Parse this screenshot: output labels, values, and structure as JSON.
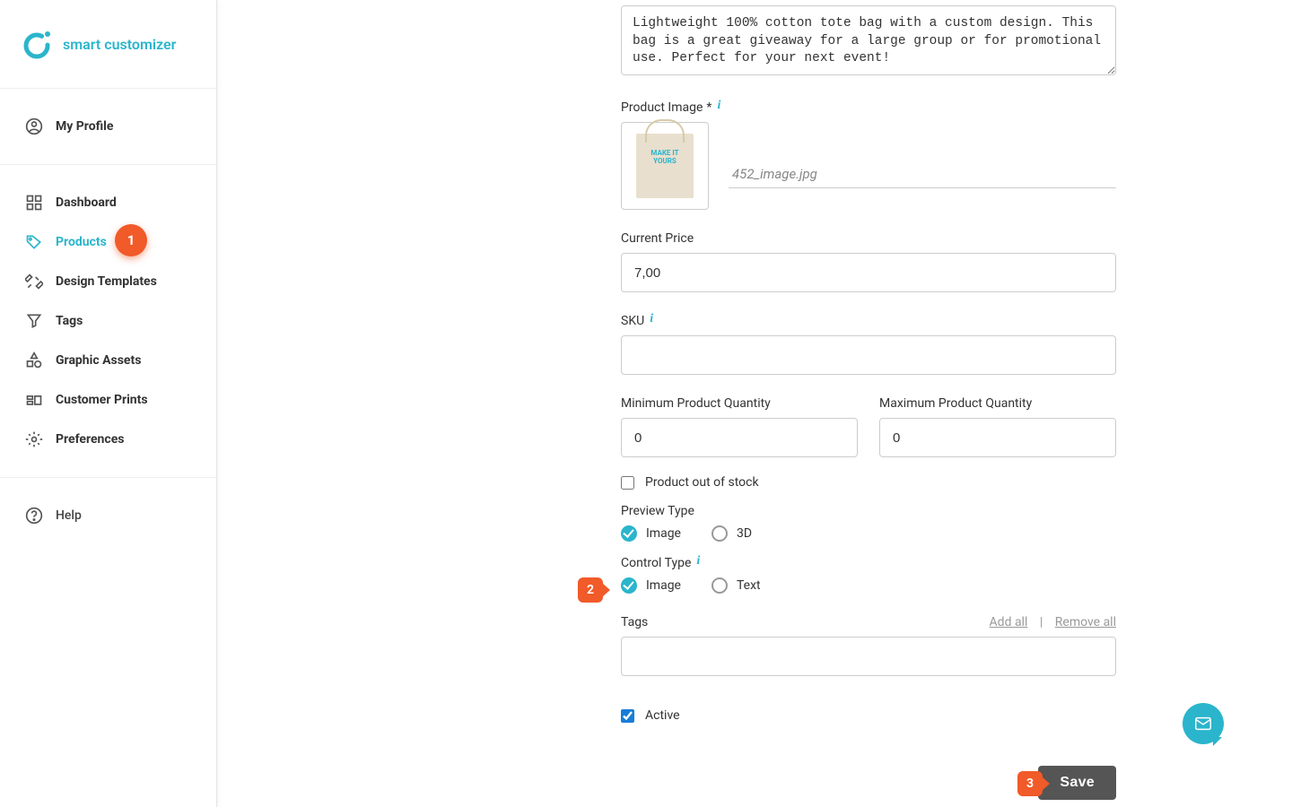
{
  "brand": {
    "name": "smart customizer"
  },
  "sidebar": {
    "items": [
      {
        "label": "My Profile"
      },
      {
        "label": "Dashboard"
      },
      {
        "label": "Products",
        "badge": "1"
      },
      {
        "label": "Design Templates"
      },
      {
        "label": "Tags"
      },
      {
        "label": "Graphic Assets"
      },
      {
        "label": "Customer Prints"
      },
      {
        "label": "Preferences"
      }
    ],
    "help": "Help"
  },
  "form": {
    "description_value": "Lightweight 100% cotton tote bag with a custom design. This bag is a great giveaway for a large group or for promotional use. Perfect for your next event!",
    "product_image_label": "Product Image",
    "image_filename": "452_image.jpg",
    "bag_text_1": "MAKE IT",
    "bag_text_2": "YOURS",
    "current_price_label": "Current Price",
    "current_price": "7,00",
    "sku_label": "SKU",
    "sku": "",
    "min_qty_label": "Minimum Product Quantity",
    "min_qty": "0",
    "max_qty_label": "Maximum Product Quantity",
    "max_qty": "0",
    "out_of_stock_label": "Product out of stock",
    "preview_type_label": "Preview Type",
    "preview_opt_image": "Image",
    "preview_opt_3d": "3D",
    "control_type_label": "Control Type",
    "control_opt_image": "Image",
    "control_opt_text": "Text",
    "tags_label": "Tags",
    "tags_add_all": "Add all",
    "tags_remove_all": "Remove all",
    "active_label": "Active",
    "save_label": "Save"
  },
  "callouts": {
    "two": "2",
    "three": "3"
  }
}
